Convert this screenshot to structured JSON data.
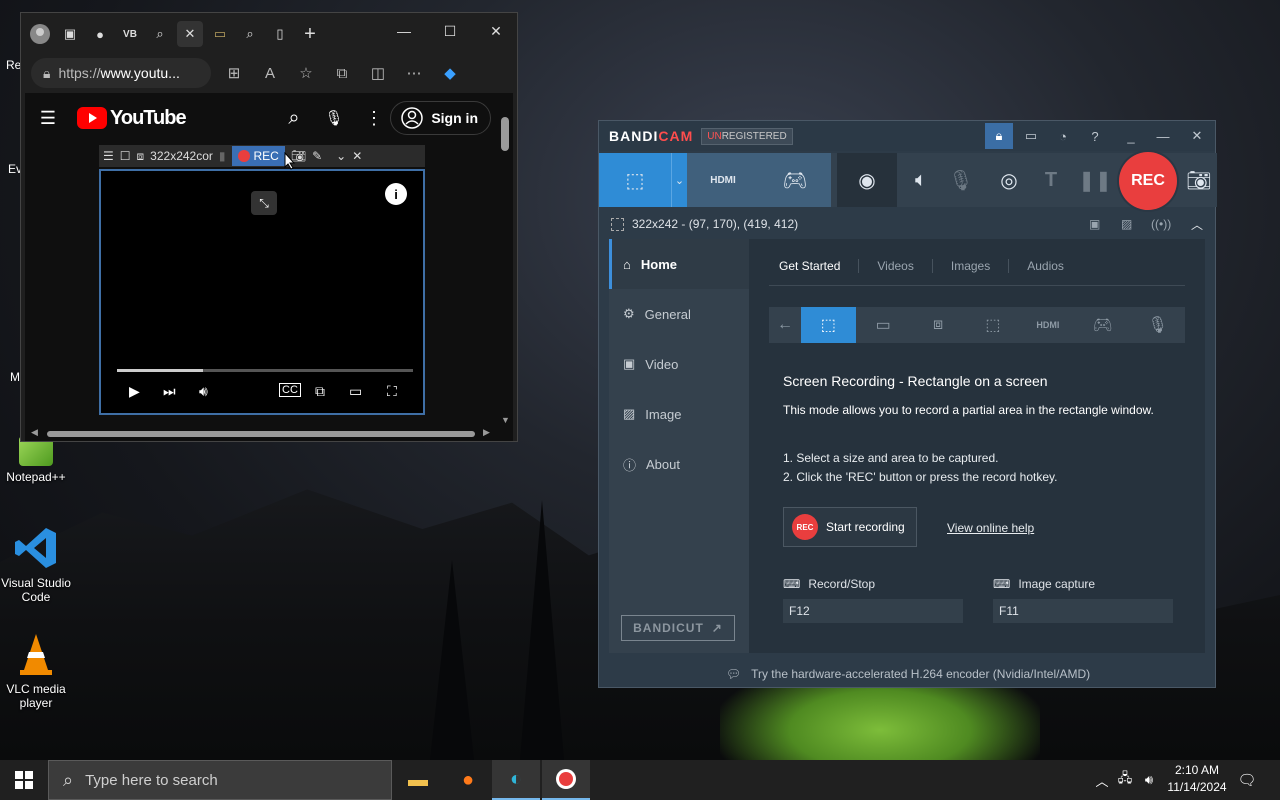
{
  "desktop": {
    "icons": [
      {
        "label": "Notepad++"
      },
      {
        "label": "Visual Studio Code"
      },
      {
        "label": "VLC media player"
      }
    ],
    "edge_labels": [
      "Re",
      "Ev",
      "M"
    ]
  },
  "browser": {
    "tab_vb": "VB",
    "url_prefix": "https://",
    "url_host": "www.youtu...",
    "youtube": {
      "brand": "YouTube",
      "signin_label": "Sign in"
    },
    "bandibar": {
      "size_text": "322x242cor",
      "rec_label": "REC"
    }
  },
  "bandicam": {
    "brand_bandi": "BANDI",
    "brand_cam": "CAM",
    "unreg_prefix": "UN",
    "unreg_rest": "REGISTERED",
    "rec_label": "REC",
    "hdmi_label": "HDMI",
    "size_readout": "322x242 - (97, 170), (419, 412)",
    "sidebar": [
      {
        "label": "Home",
        "active": true
      },
      {
        "label": "General"
      },
      {
        "label": "Video"
      },
      {
        "label": "Image"
      },
      {
        "label": "About"
      }
    ],
    "bandicut_label": "BANDICUT",
    "tabs": [
      "Get Started",
      "Videos",
      "Images",
      "Audios"
    ],
    "heading": "Screen Recording - Rectangle on a screen",
    "description": "This mode allows you to record a partial area in the rectangle window.",
    "steps": [
      "1. Select a size and area to be captured.",
      "2. Click the 'REC' button or press the record hotkey."
    ],
    "start_recording_label": "Start recording",
    "rec_badge": "REC",
    "help_link": "View online help",
    "hotkeys": {
      "record_label": "Record/Stop",
      "record_value": "F12",
      "image_label": "Image capture",
      "image_value": "F11"
    },
    "footer_tip": "Try the hardware-accelerated H.264 encoder (Nvidia/Intel/AMD)",
    "accent": "#2f8cd6",
    "rec_color": "#e93e3e"
  },
  "taskbar": {
    "search_placeholder": "Type here to search",
    "time": "2:10 AM",
    "date": "11/14/2024"
  }
}
